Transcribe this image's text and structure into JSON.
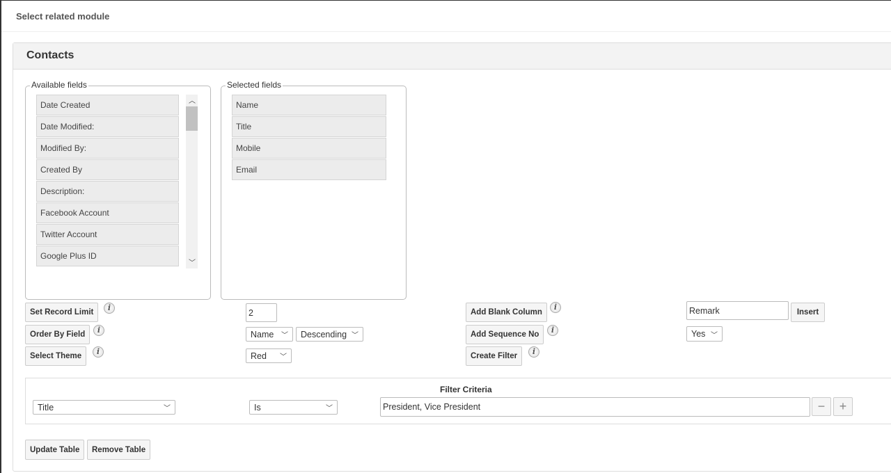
{
  "modal": {
    "title": "Select related module"
  },
  "panel": {
    "title": "Contacts"
  },
  "available": {
    "legend": "Available fields",
    "items": [
      "Date Created",
      "Date Modified:",
      "Modified By:",
      "Created By",
      "Description:",
      "Facebook Account",
      "Twitter Account",
      "Google Plus ID"
    ]
  },
  "selected": {
    "legend": "Selected fields",
    "items": [
      "Name",
      "Title",
      "Mobile",
      "Email"
    ]
  },
  "controls": {
    "record_limit": {
      "label": "Set Record Limit",
      "value": "2"
    },
    "order_by": {
      "label": "Order By Field",
      "field": "Name",
      "direction": "Descending"
    },
    "theme": {
      "label": "Select Theme",
      "value": "Red"
    },
    "blank_column": {
      "label": "Add Blank Column",
      "value": "Remark",
      "insert": "Insert"
    },
    "sequence": {
      "label": "Add Sequence No",
      "value": "Yes"
    },
    "filter": {
      "label": "Create Filter"
    }
  },
  "filter": {
    "heading": "Filter Criteria",
    "field": "Title",
    "operator": "Is",
    "value": "President, Vice President",
    "remove": "−",
    "add": "+"
  },
  "actions": {
    "update": "Update Table",
    "remove": "Remove Table"
  },
  "icons": {
    "info": "i"
  }
}
